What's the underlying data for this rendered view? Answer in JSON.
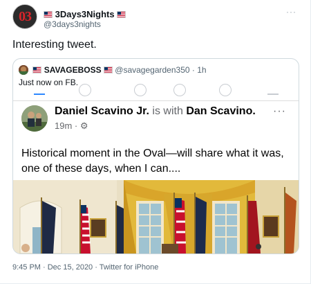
{
  "tweet": {
    "display_name": "3Days3Nights",
    "handle": "@3days3nights",
    "avatar_text": "03",
    "more": "···",
    "text": "Interesting tweet.",
    "footer": "9:45 PM · Dec 15, 2020 · Twitter for iPhone"
  },
  "quote": {
    "display_name": "SAVAGEBOSS",
    "handle": "@savagegarden350",
    "time": "· 1h",
    "text": "Just now on FB."
  },
  "fb_post": {
    "author": "Daniel Scavino Jr.",
    "with_text": "is with",
    "tagged": "Dan Scavino.",
    "time": "19m ·",
    "more": "···",
    "text": "Historical moment in the Oval—will share what it was, one of these days, when I can...."
  },
  "colors": {
    "accent": "#2d88ff",
    "secondary_text": "#536471",
    "border": "#cfd9de"
  }
}
